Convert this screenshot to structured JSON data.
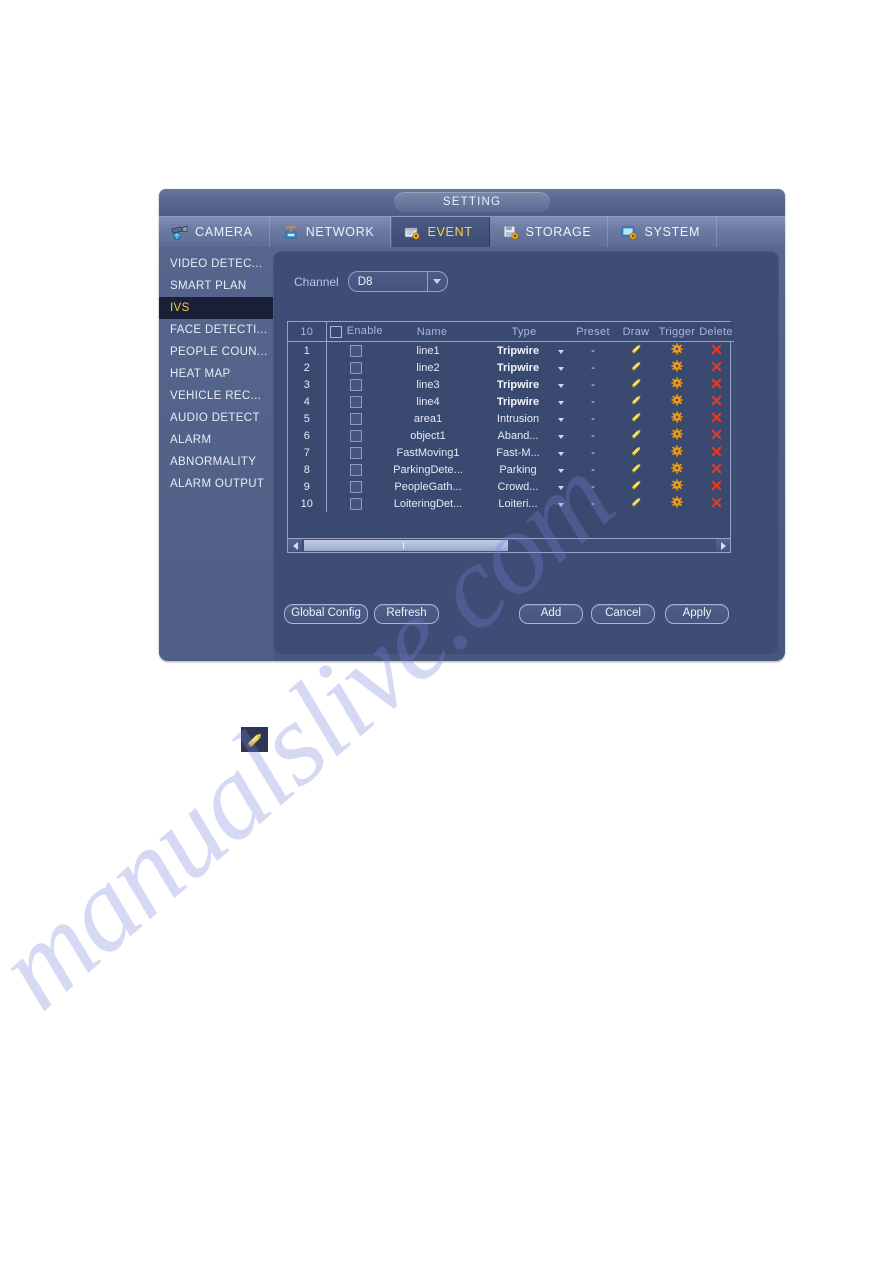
{
  "window": {
    "title": "SETTING"
  },
  "tabs": [
    {
      "label": "CAMERA",
      "icon": "camera-icon",
      "active": false
    },
    {
      "label": "NETWORK",
      "icon": "network-icon",
      "active": false
    },
    {
      "label": "EVENT",
      "icon": "event-icon",
      "active": true
    },
    {
      "label": "STORAGE",
      "icon": "storage-icon",
      "active": false
    },
    {
      "label": "SYSTEM",
      "icon": "system-icon",
      "active": false
    }
  ],
  "sidebar": {
    "items": [
      {
        "label": "VIDEO DETEC...",
        "active": false
      },
      {
        "label": "SMART PLAN",
        "active": false
      },
      {
        "label": "IVS",
        "active": true
      },
      {
        "label": "FACE DETECTI...",
        "active": false
      },
      {
        "label": "PEOPLE COUN...",
        "active": false
      },
      {
        "label": "HEAT MAP",
        "active": false
      },
      {
        "label": "VEHICLE REC...",
        "active": false
      },
      {
        "label": "AUDIO DETECT",
        "active": false
      },
      {
        "label": "ALARM",
        "active": false
      },
      {
        "label": "ABNORMALITY",
        "active": false
      },
      {
        "label": "ALARM OUTPUT",
        "active": false
      }
    ]
  },
  "channel": {
    "label": "Channel",
    "value": "D8"
  },
  "table": {
    "headers": {
      "count": "10",
      "enable": "Enable",
      "name": "Name",
      "type": "Type",
      "preset": "Preset",
      "draw": "Draw",
      "trigger": "Trigger",
      "delete": "Delete"
    },
    "rows": [
      {
        "idx": "1",
        "enabled": false,
        "name": "line1",
        "type": "Tripwire",
        "type_bold": true,
        "preset": "-"
      },
      {
        "idx": "2",
        "enabled": false,
        "name": "line2",
        "type": "Tripwire",
        "type_bold": true,
        "preset": "-"
      },
      {
        "idx": "3",
        "enabled": false,
        "name": "line3",
        "type": "Tripwire",
        "type_bold": true,
        "preset": "-"
      },
      {
        "idx": "4",
        "enabled": false,
        "name": "line4",
        "type": "Tripwire",
        "type_bold": true,
        "preset": "-"
      },
      {
        "idx": "5",
        "enabled": false,
        "name": "area1",
        "type": "Intrusion",
        "type_bold": false,
        "preset": "-"
      },
      {
        "idx": "6",
        "enabled": false,
        "name": "object1",
        "type": "Aband...",
        "type_bold": false,
        "preset": "-"
      },
      {
        "idx": "7",
        "enabled": false,
        "name": "FastMoving1",
        "type": "Fast-M...",
        "type_bold": false,
        "preset": "-"
      },
      {
        "idx": "8",
        "enabled": false,
        "name": "ParkingDete...",
        "type": "Parking",
        "type_bold": false,
        "preset": "-"
      },
      {
        "idx": "9",
        "enabled": false,
        "name": "PeopleGath...",
        "type": "Crowd...",
        "type_bold": false,
        "preset": "-"
      },
      {
        "idx": "10",
        "enabled": false,
        "name": "LoiteringDet...",
        "type": "Loiteri...",
        "type_bold": false,
        "preset": "-"
      }
    ]
  },
  "footer": {
    "global_config": "Global Config",
    "refresh": "Refresh",
    "add": "Add",
    "cancel": "Cancel",
    "apply": "Apply"
  },
  "standalone_icon": {
    "name": "pencil-icon"
  },
  "watermark": {
    "text": "manualslive.com"
  },
  "colors": {
    "accent_yellow": "#f7c942",
    "pencil": "#e8c63a",
    "gear": "#f0a31e",
    "delete_x": "#e03a28",
    "window_bg": "#4e5e85",
    "panel_bg": "#3e4d75",
    "selected_bg": "#1a2038"
  }
}
